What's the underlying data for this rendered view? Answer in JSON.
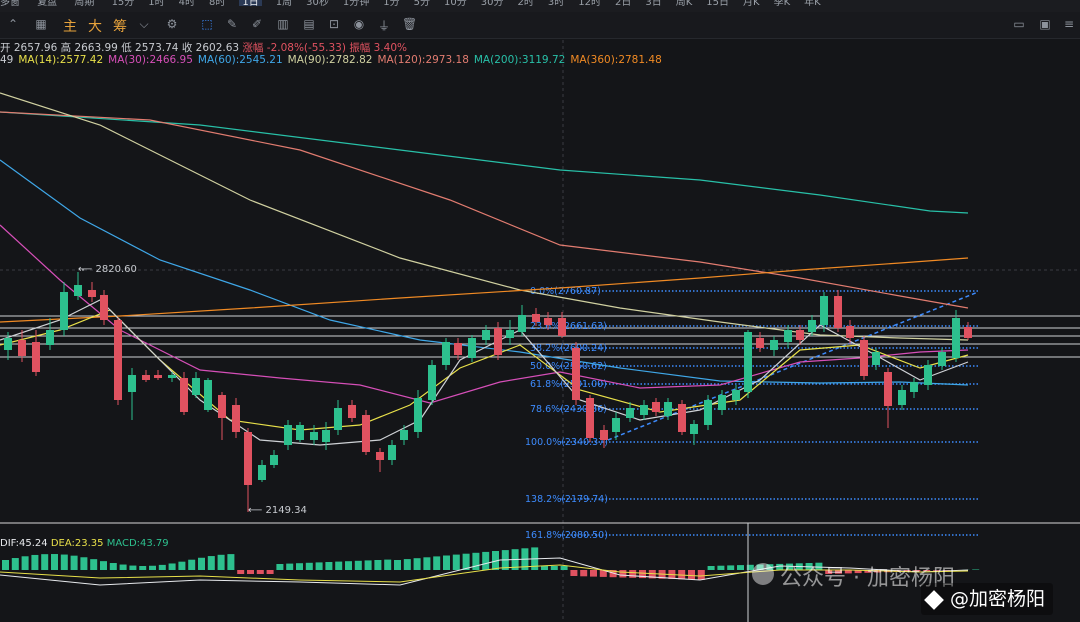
{
  "toolbar": {
    "left_label": "多窗",
    "layout_label": "复盘",
    "period_label": "周期",
    "periods": [
      "15分",
      "1时",
      "4时",
      "8时",
      "1日",
      "1周",
      "30秒",
      "1分钟",
      "1分",
      "5分",
      "10分",
      "30分",
      "2时",
      "3时",
      "12时",
      "2日",
      "3日",
      "周K",
      "15日",
      "月K",
      "季K",
      "年K"
    ],
    "active_period": "1日",
    "buttons": [
      "主",
      "大",
      "筹"
    ]
  },
  "ohlc": {
    "open": "开 2657.96",
    "high": "高 2663.99",
    "low": "低 2573.74",
    "close": "收 2602.63",
    "change": "涨幅 -2.08%(-55.33)",
    "amplitude": "振幅 3.40%"
  },
  "ma_row": [
    {
      "text": "49",
      "color": "#c8cbd0"
    },
    {
      "text": "MA(14):2577.42",
      "color": "#e8e04a"
    },
    {
      "text": "MA(30):2466.95",
      "color": "#d64fb8"
    },
    {
      "text": "MA(60):2545.21",
      "color": "#3fa7e8"
    },
    {
      "text": "MA(90):2782.82",
      "color": "#d0d0a0"
    },
    {
      "text": "MA(120):2973.18",
      "color": "#e27c70"
    },
    {
      "text": "MA(200):3119.72",
      "color": "#28c0a8"
    },
    {
      "text": "MA(360):2781.48",
      "color": "#f08a24"
    }
  ],
  "price_marks": {
    "high": "2820.60",
    "low": "2149.34"
  },
  "fib_levels": [
    {
      "label": "0.0%(2760.87)"
    },
    {
      "label": "23.6%(2661.63)"
    },
    {
      "label": "38.2%(2600.24)"
    },
    {
      "label": "50.0%(2550.62)"
    },
    {
      "label": "61.8%(2501.00)"
    },
    {
      "label": "78.6%(2430.36)"
    },
    {
      "label": "100.0%(2340.37)"
    },
    {
      "label": "138.2%(2179.74)"
    },
    {
      "label": "161.8%(2080.50)"
    }
  ],
  "macd": {
    "dif": "DIF:45.24",
    "dea": "DEA:23.35",
    "macd": "MACD:43.79",
    "dif_color": "#e8eaed",
    "dea_color": "#e8e04a",
    "macd_color": "#2dc08e"
  },
  "watermark": {
    "text": "公众号 · 加密杨阳",
    "badge": "@加密杨阳"
  },
  "colors": {
    "up": "#2dc08e",
    "down": "#e05260",
    "fib": "#3d8bfd"
  }
}
